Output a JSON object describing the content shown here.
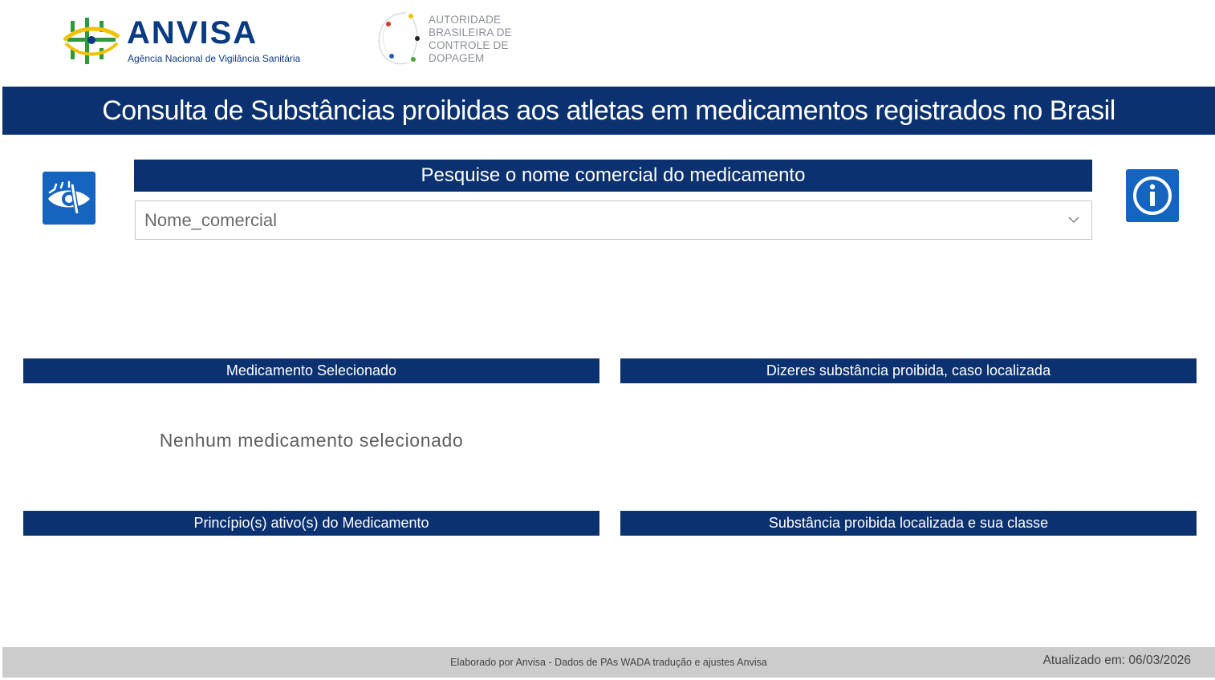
{
  "header": {
    "anvisa_wordmark": "ANVISA",
    "anvisa_tagline": "Agência Nacional de Vigilância Sanitária",
    "abcd_lines": [
      "AUTORIDADE",
      "BRASILEIRA DE",
      "CONTROLE DE",
      "DOPAGEM"
    ],
    "title": "Consulta de Substâncias proibidas aos atletas em medicamentos registrados no Brasil"
  },
  "search": {
    "header": "Pesquise o nome comercial do medicamento",
    "placeholder": "Nome_comercial"
  },
  "icons": {
    "accessibility": "eye-icon",
    "info": "info-icon",
    "dropdown": "chevron-down-icon"
  },
  "sections": {
    "medicamento": "Medicamento Selecionado",
    "dizeres": "Dizeres substância proibida, caso localizada",
    "principio": "Princípio(s) ativo(s) do Medicamento",
    "substancia": "Substância proibida localizada e sua classe"
  },
  "empty_message": "Nenhum medicamento selecionado",
  "footer": {
    "credit": "Elaborado por Anvisa - Dados de PAs WADA tradução e ajustes Anvisa",
    "updated": "Atualizado em: 06/03/2026"
  },
  "colors": {
    "banner": "#0b3170",
    "button": "#1565c0",
    "footer": "#cccccc"
  }
}
